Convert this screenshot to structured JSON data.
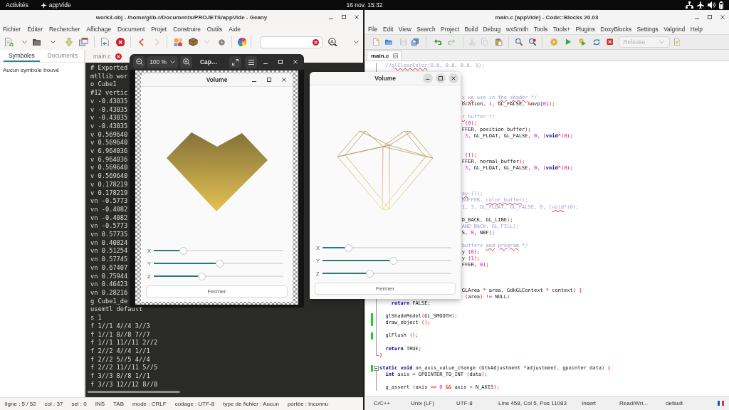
{
  "top_bar": {
    "activities": "Activités",
    "app": "appVide",
    "clock": "16 nov. 15:32"
  },
  "geany": {
    "title": "work3.obj - /home/gilb-r/Documents/PROJETS/appVide - Geany",
    "menu": [
      "Fichier",
      "Éditer",
      "Rechercher",
      "Affichage",
      "Document",
      "Projet",
      "Construire",
      "Outils",
      "Aide"
    ],
    "toolbar": [
      {
        "disabled": false
      },
      {
        "disabled": false
      },
      {
        "disabled": false
      },
      {
        "disabled": false
      },
      {
        "disabled": false
      },
      {
        "disabled": false
      },
      {
        "disabled": false
      },
      {
        "disabled": false
      },
      {
        "disabled": false
      },
      {
        "disabled": true
      },
      {
        "disabled": false
      },
      {
        "disabled": false
      },
      {
        "disabled": true
      },
      {
        "disabled": false
      },
      {
        "disabled": false
      },
      {
        "disabled": false
      },
      {
        "disabled": false
      }
    ],
    "sidebar_tabs": [
      {
        "label": "Symboles",
        "selected": true
      },
      {
        "label": "Documents",
        "selected": false
      }
    ],
    "sidebar_message": "Aucun symbole trouvé",
    "editor_tabs": [
      {
        "label": "main.c",
        "selected": false
      }
    ],
    "code_lines": [
      "# Exported",
      "mtllib wor",
      "o Cube1",
      "#12 vertic",
      "v -0.43035",
      "v -0.43035",
      "v -0.43035",
      "v -0.43035",
      "v 0.569640",
      "v 0.569640",
      "v 6.964036",
      "v 6.964036",
      "v 0.569640",
      "v 0.569640",
      "v 0.178219",
      "v 0.178219",
      "vn -0.5773",
      "vn -0.4082",
      "vn -0.4082",
      "vn -0.5773",
      "vn 0.57735",
      "vn 0.40824",
      "vn 0.51254",
      "vn 0.57745",
      "vn 0.67407",
      "vn 0.75944",
      "vn 0.46423",
      "vn 0.28216",
      "g Cube1_de",
      "usemtl default",
      "s 1",
      "f 1//1 4//4 3//3",
      "f 1//1 8//8 7//7",
      "f 1//1 11//11 2//2",
      "f 2//2 4//4 1//1",
      "f 2//2 5//5 4//4",
      "f 2//2 11//11 5//5",
      "f 3//3 8//8 1//1",
      "f 3//3 12//12 8//8"
    ],
    "status_bar": [
      "ligne : 5 / 52",
      "col : 37",
      "sel : 0",
      "INS",
      "TAB",
      "mode : CRLF",
      "codage : UTF-8",
      "type de fichier : Aucun",
      "portée : inconnu"
    ]
  },
  "codeblocks": {
    "title": "main.c [appVide] - Code::Blocks 20.03",
    "menu": [
      "File",
      "Edit",
      "View",
      "Search",
      "Project",
      "Build",
      "Debug",
      "wxSmith",
      "Tools",
      "Tools+",
      "Plugins",
      "DoxyBlocks",
      "Settings",
      "Valgrind",
      "Help"
    ],
    "toolbar": [
      {
        "disabled": false
      },
      {
        "disabled": false
      },
      {
        "disabled": true
      },
      {
        "disabled": false
      },
      {
        "disabled": false
      },
      {
        "disabled": true
      },
      {
        "disabled": true
      },
      {
        "disabled": true
      },
      {
        "disabled": false
      },
      {
        "disabled": false
      },
      {
        "disabled": false
      },
      {
        "disabled": false
      },
      {
        "disabled": false
      },
      {
        "disabled": false
      },
      {
        "disabled": false
      },
      {
        "disabled": false
      },
      {
        "disabled": false
      }
    ],
    "build_target": {
      "value": "Release",
      "disabled": true
    },
    "editor_tabs": [
      {
        "label": "main.c",
        "selected": true
      }
    ],
    "code_lines": [
      {
        "kind": "code",
        "changed": false,
        "fold_start": false,
        "fold_end": false,
        "segs": [
          {
            "kind": "comment",
            "text": "  //"
          },
          {
            "kind": "misspelled",
            "text": "glClearColor"
          },
          {
            "kind": "comment",
            "text": "(0.8, 0.8, 0.8, 1);"
          }
        ]
      },
      {
        "kind": "blank"
      },
      {
        "kind": "blank"
      },
      {
        "kind": "blank"
      },
      {
        "kind": "blank"
      },
      {
        "kind": "cut",
        "segs": [
          {
            "kind": "misspelled",
            "text": "x"
          },
          {
            "kind": "misspelled",
            "text": " we"
          },
          {
            "kind": "comment",
            "text": " use in"
          },
          {
            "kind": "misspelled",
            "text": " the"
          },
          {
            "kind": "misspelled",
            "text": " shader"
          },
          {
            "kind": "comment",
            "text": " */"
          }
        ]
      },
      {
        "kind": "cut",
        "segs": [
          {
            "kind": "plain",
            "text": "ocation"
          },
          {
            "kind": "operator",
            "text": ","
          },
          {
            "kind": "number",
            "text": " 1"
          },
          {
            "kind": "operator",
            "text": ","
          },
          {
            "kind": "plain",
            "text": " GL_FALSE"
          },
          {
            "kind": "operator",
            "text": ","
          },
          {
            "kind": "operator",
            "text": " &"
          },
          {
            "kind": "plain",
            "text": "mvp"
          },
          {
            "kind": "operator",
            "text": "["
          },
          {
            "kind": "number",
            "text": "0"
          },
          {
            "kind": "operator",
            "text": "]);"
          }
        ]
      },
      {
        "kind": "blank"
      },
      {
        "kind": "cut",
        "segs": [
          {
            "kind": "misspelled",
            "text": "r"
          },
          {
            "kind": "comment",
            "text": " buffer */"
          }
        ]
      },
      {
        "kind": "cut",
        "segs": [
          {
            "kind": "operator",
            "text": " ("
          },
          {
            "kind": "number",
            "text": "0"
          },
          {
            "kind": "operator",
            "text": ");"
          }
        ]
      },
      {
        "kind": "cut",
        "segs": [
          {
            "kind": "plain",
            "text": "FFER"
          },
          {
            "kind": "operator",
            "text": ","
          },
          {
            "kind": "plain",
            "text": " position_buffer"
          },
          {
            "kind": "operator",
            "text": ");"
          }
        ]
      },
      {
        "kind": "cut",
        "segs": [
          {
            "kind": "number",
            "text": " 3"
          },
          {
            "kind": "operator",
            "text": ","
          },
          {
            "kind": "plain",
            "text": " GL_FLOAT"
          },
          {
            "kind": "operator",
            "text": ","
          },
          {
            "kind": "plain",
            "text": " GL_FALSE"
          },
          {
            "kind": "operator",
            "text": ","
          },
          {
            "kind": "number",
            "text": " 0"
          },
          {
            "kind": "operator",
            "text": ","
          },
          {
            "kind": "operator",
            "text": " ("
          },
          {
            "kind": "keyword",
            "text": "void"
          },
          {
            "kind": "operator",
            "text": "*)"
          },
          {
            "kind": "number",
            "text": "0"
          },
          {
            "kind": "operator",
            "text": ");"
          }
        ]
      },
      {
        "kind": "blank"
      },
      {
        "kind": "blank"
      },
      {
        "kind": "cut",
        "segs": [
          {
            "kind": "operator",
            "text": " ("
          },
          {
            "kind": "number",
            "text": "1"
          },
          {
            "kind": "operator",
            "text": ");"
          }
        ]
      },
      {
        "kind": "cut",
        "segs": [
          {
            "kind": "plain",
            "text": "FFER"
          },
          {
            "kind": "operator",
            "text": ","
          },
          {
            "kind": "plain",
            "text": " normal_buffer"
          },
          {
            "kind": "operator",
            "text": ");"
          }
        ]
      },
      {
        "kind": "cut",
        "segs": [
          {
            "kind": "number",
            "text": " 3"
          },
          {
            "kind": "operator",
            "text": ","
          },
          {
            "kind": "plain",
            "text": " GL_FLOAT"
          },
          {
            "kind": "operator",
            "text": ","
          },
          {
            "kind": "plain",
            "text": " GL_FALSE"
          },
          {
            "kind": "operator",
            "text": ","
          },
          {
            "kind": "number",
            "text": " 0"
          },
          {
            "kind": "operator",
            "text": ","
          },
          {
            "kind": "operator",
            "text": " ("
          },
          {
            "kind": "keyword",
            "text": "void"
          },
          {
            "kind": "operator",
            "text": "*)"
          },
          {
            "kind": "number",
            "text": "0"
          },
          {
            "kind": "operator",
            "text": ");"
          }
        ]
      },
      {
        "kind": "blank"
      },
      {
        "kind": "blank"
      },
      {
        "kind": "blank"
      },
      {
        "kind": "cut",
        "segs": [
          {
            "kind": "misspelled",
            "text": "ay"
          },
          {
            "kind": "comment",
            "text": " (1);"
          }
        ]
      },
      {
        "kind": "cut",
        "segs": [
          {
            "kind": "comment",
            "text": "BUFFER,"
          },
          {
            "kind": "misspelled",
            "text": " color_buffer"
          },
          {
            "kind": "comment",
            "text": ");"
          }
        ]
      },
      {
        "kind": "cut",
        "segs": [
          {
            "kind": "comment",
            "text": "1, 3, GL_FLOAT, GL_FALSE, 0, ("
          },
          {
            "kind": "misspelled",
            "text": "void"
          },
          {
            "kind": "comment",
            "text": "*)0);"
          }
        ]
      },
      {
        "kind": "blank"
      },
      {
        "kind": "cut",
        "segs": [
          {
            "kind": "plain",
            "text": "D_BACK"
          },
          {
            "kind": "operator",
            "text": ","
          },
          {
            "kind": "plain",
            "text": " GL_LINE"
          },
          {
            "kind": "operator",
            "text": ");"
          }
        ]
      },
      {
        "kind": "cut",
        "segs": [
          {
            "kind": "comment",
            "text": "AND_BACK, GL_FILL);"
          }
        ]
      },
      {
        "kind": "cut",
        "segs": [
          {
            "kind": "plain",
            "text": "S"
          },
          {
            "kind": "operator",
            "text": ","
          },
          {
            "kind": "number",
            "text": " 0"
          },
          {
            "kind": "operator",
            "text": ","
          },
          {
            "kind": "plain",
            "text": " NBF"
          },
          {
            "kind": "operator",
            "text": ");"
          }
        ]
      },
      {
        "kind": "blank"
      },
      {
        "kind": "cut",
        "segs": [
          {
            "kind": "comment",
            "text": "buffers"
          },
          {
            "kind": "misspelled",
            "text": " and"
          },
          {
            "kind": "misspelled",
            "text": " program"
          },
          {
            "kind": "comment",
            "text": " */"
          }
        ]
      },
      {
        "kind": "cut",
        "segs": [
          {
            "kind": "plain",
            "text": "y"
          },
          {
            "kind": "operator",
            "text": " ("
          },
          {
            "kind": "number",
            "text": "0"
          },
          {
            "kind": "operator",
            "text": ");"
          }
        ]
      },
      {
        "kind": "cut",
        "segs": [
          {
            "kind": "plain",
            "text": "y"
          },
          {
            "kind": "operator",
            "text": " ("
          },
          {
            "kind": "number",
            "text": "1"
          },
          {
            "kind": "operator",
            "text": ");"
          }
        ]
      },
      {
        "kind": "cut",
        "segs": [
          {
            "kind": "plain",
            "text": "FFER"
          },
          {
            "kind": "operator",
            "text": ","
          },
          {
            "kind": "number",
            "text": " 0"
          },
          {
            "kind": "operator",
            "text": ");"
          }
        ]
      },
      {
        "kind": "blank"
      },
      {
        "kind": "blank"
      },
      {
        "kind": "blank"
      },
      {
        "kind": "cut",
        "segs": [
          {
            "kind": "plain",
            "text": "GLArea"
          },
          {
            "kind": "operator",
            "text": " *"
          },
          {
            "kind": "plain",
            "text": " area"
          },
          {
            "kind": "operator",
            "text": ","
          },
          {
            "kind": "plain",
            "text": " GdkGLContext"
          },
          {
            "kind": "operator",
            "text": " *"
          },
          {
            "kind": "plain",
            "text": " context"
          },
          {
            "kind": "operator",
            "text": ")"
          },
          {
            "kind": "operator",
            "text": " {"
          }
        ]
      },
      {
        "kind": "cut",
        "segs": [
          {
            "kind": "operator",
            "text": " ("
          },
          {
            "kind": "plain",
            "text": "area"
          },
          {
            "kind": "operator",
            "text": ")"
          },
          {
            "kind": "operator",
            "text": " !="
          },
          {
            "kind": "plain",
            "text": " NULL"
          },
          {
            "kind": "operator",
            "text": ")"
          }
        ]
      },
      {
        "kind": "code",
        "changed": false,
        "fold_start": false,
        "fold_end": false,
        "segs": [
          {
            "kind": "keyword",
            "text": "    return"
          },
          {
            "kind": "plain",
            "text": " FALSE"
          },
          {
            "kind": "operator",
            "text": ";"
          }
        ]
      },
      {
        "kind": "blank",
        "changed": false,
        "fold_start": false,
        "fold_end": false
      },
      {
        "kind": "code",
        "changed": true,
        "fold_start": false,
        "fold_end": false,
        "segs": [
          {
            "kind": "plain",
            "text": "  glShadeModel"
          },
          {
            "kind": "operator",
            "text": "("
          },
          {
            "kind": "plain",
            "text": "GL_SMOOTH"
          },
          {
            "kind": "operator",
            "text": ");"
          }
        ]
      },
      {
        "kind": "code",
        "changed": true,
        "fold_start": false,
        "fold_end": false,
        "segs": [
          {
            "kind": "plain",
            "text": "  draw_object"
          },
          {
            "kind": "operator",
            "text": " ();"
          }
        ]
      },
      {
        "kind": "blank",
        "changed": false,
        "fold_start": false,
        "fold_end": false
      },
      {
        "kind": "code",
        "changed": true,
        "fold_start": false,
        "fold_end": false,
        "segs": [
          {
            "kind": "plain",
            "text": "  glFlush"
          },
          {
            "kind": "operator",
            "text": " ();"
          }
        ]
      },
      {
        "kind": "blank",
        "changed": false,
        "fold_start": false,
        "fold_end": false
      },
      {
        "kind": "code",
        "changed": false,
        "fold_start": false,
        "fold_end": false,
        "segs": [
          {
            "kind": "keyword",
            "text": "  return"
          },
          {
            "kind": "plain",
            "text": " TRUE"
          },
          {
            "kind": "operator",
            "text": ";"
          }
        ]
      },
      {
        "kind": "code",
        "changed": false,
        "fold_start": false,
        "fold_end": true,
        "segs": [
          {
            "kind": "operator",
            "text": "}"
          }
        ]
      },
      {
        "kind": "blank",
        "changed": false,
        "fold_start": false,
        "fold_end": false
      },
      {
        "kind": "code",
        "changed": true,
        "fold_start": true,
        "fold_end": false,
        "segs": [
          {
            "kind": "keyword",
            "text": "static"
          },
          {
            "kind": "keyword",
            "text": " void"
          },
          {
            "kind": "plain",
            "text": " on_axis_value_change"
          },
          {
            "kind": "operator",
            "text": " ("
          },
          {
            "kind": "plain",
            "text": "GtkAdjustment"
          },
          {
            "kind": "operator",
            "text": " *"
          },
          {
            "kind": "plain",
            "text": "adjustment"
          },
          {
            "kind": "operator",
            "text": ","
          },
          {
            "kind": "plain",
            "text": " gpointer data"
          },
          {
            "kind": "operator",
            "text": ")"
          },
          {
            "kind": "operator",
            "text": " {"
          }
        ]
      },
      {
        "kind": "code",
        "changed": false,
        "fold_start": false,
        "fold_end": false,
        "segs": [
          {
            "kind": "keyword",
            "text": "  int"
          },
          {
            "kind": "plain",
            "text": " axis"
          },
          {
            "kind": "operator",
            "text": " ="
          },
          {
            "kind": "plain",
            "text": " GPOINTER_TO_INT"
          },
          {
            "kind": "operator",
            "text": " ("
          },
          {
            "kind": "plain",
            "text": "data"
          },
          {
            "kind": "operator",
            "text": ");"
          }
        ]
      },
      {
        "kind": "blank",
        "changed": false,
        "fold_start": false,
        "fold_end": false
      },
      {
        "kind": "code",
        "changed": false,
        "fold_start": false,
        "fold_end": false,
        "segs": [
          {
            "kind": "plain",
            "text": "  g_assert"
          },
          {
            "kind": "operator",
            "text": " ("
          },
          {
            "kind": "plain",
            "text": "axis"
          },
          {
            "kind": "operator",
            "text": " >="
          },
          {
            "kind": "number",
            "text": " 0"
          },
          {
            "kind": "operator",
            "text": " &&"
          },
          {
            "kind": "plain",
            "text": " axis"
          },
          {
            "kind": "operator",
            "text": " <"
          },
          {
            "kind": "plain",
            "text": " N_AXIS"
          },
          {
            "kind": "operator",
            "text": ");"
          }
        ]
      }
    ],
    "status_bar": [
      "C/C++",
      "Unix (LF)",
      "UTF-8",
      "Line 458, Col 5, Pos 11083",
      "Insert",
      "Read/Wri...",
      "default"
    ]
  },
  "image_viewer": {
    "zoom": "100 %",
    "title": "Cap…",
    "screenshot": {
      "title": "Volume",
      "active": false,
      "model": {
        "kind": "filled"
      },
      "sliders": [
        {
          "label": "X",
          "level": 0.23
        },
        {
          "label": "Y",
          "level": 0.51
        },
        {
          "label": "Z",
          "level": 0.37
        }
      ],
      "button": "Fermer"
    }
  },
  "volume_window": {
    "title": "Volume",
    "active": true,
    "model": {
      "kind": "wireframe"
    },
    "sliders": [
      {
        "label": "X",
        "level": 0.2
      },
      {
        "label": "Y",
        "level": 0.55
      },
      {
        "label": "Z",
        "level": 0.37
      }
    ],
    "button": "Fermer"
  }
}
